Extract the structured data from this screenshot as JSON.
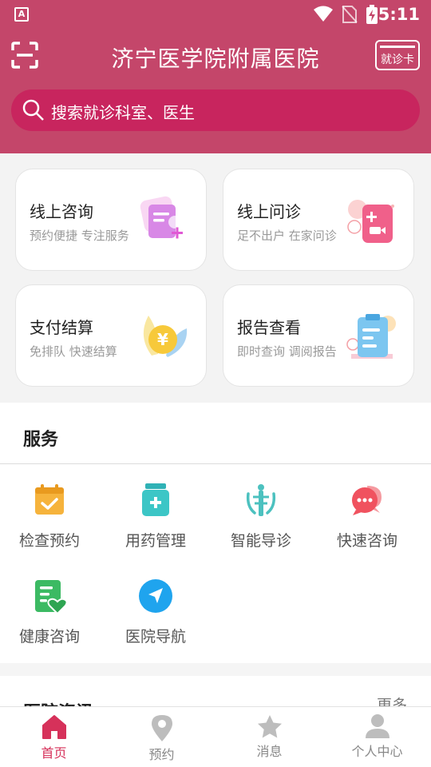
{
  "status_bar": {
    "time": "5:11",
    "app_icon_letter": "A"
  },
  "header": {
    "title": "济宁医学院附属医院",
    "scan_icon": "scan-icon",
    "card_button_label": "就诊卡",
    "background_color": "#c4466a"
  },
  "search": {
    "placeholder": "搜索就诊科室、医生",
    "background_color": "#c8255e"
  },
  "quick_cards": [
    {
      "title": "线上咨询",
      "subtitle": "预约便捷  专注服务",
      "icon": "document-plus-icon"
    },
    {
      "title": "线上问诊",
      "subtitle": "足不出户  在家问诊",
      "icon": "video-consult-icon"
    },
    {
      "title": "支付结算",
      "subtitle": "免排队  快速结算",
      "icon": "yuan-coin-icon"
    },
    {
      "title": "报告查看",
      "subtitle": "即时查询  调阅报告",
      "icon": "clipboard-report-icon"
    }
  ],
  "services": {
    "heading": "服务",
    "items": [
      {
        "label": "检查预约",
        "icon": "calendar-check-icon",
        "color": "#f6b33c"
      },
      {
        "label": "用药管理",
        "icon": "medicine-bottle-icon",
        "color": "#3cc6c6"
      },
      {
        "label": "智能导诊",
        "icon": "medical-symbol-icon",
        "color": "#4cc1bf"
      },
      {
        "label": "快速咨询",
        "icon": "chat-bubble-icon",
        "color": "#f0525f"
      },
      {
        "label": "健康咨询",
        "icon": "health-document-icon",
        "color": "#3cba63"
      },
      {
        "label": "医院导航",
        "icon": "navigation-arrow-icon",
        "color": "#1fa4ee"
      }
    ]
  },
  "news": {
    "heading": "医院资讯",
    "more_label": "更多"
  },
  "bottom_nav": {
    "active_color": "#d6315a",
    "items": [
      {
        "label": "首页",
        "icon": "home-icon"
      },
      {
        "label": "预约",
        "icon": "location-pin-icon"
      },
      {
        "label": "消息",
        "icon": "star-icon"
      },
      {
        "label": "个人中心",
        "icon": "person-icon"
      }
    ]
  }
}
